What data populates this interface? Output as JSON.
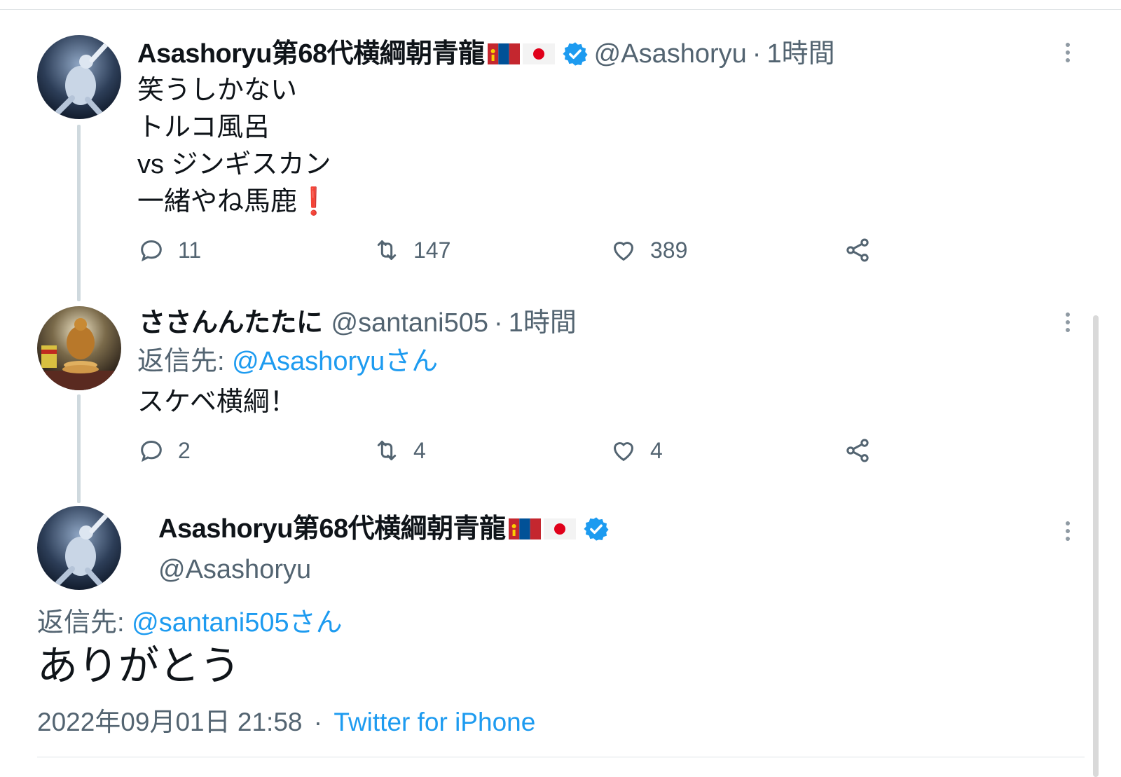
{
  "colors": {
    "accent": "#1d9bf0",
    "secondary_text": "#536471",
    "thread_line": "#cfd9de"
  },
  "tweet1": {
    "name": "Asashoryu第68代横綱朝青龍",
    "handle": "@Asashoryu",
    "separator": "·",
    "time": "1時間",
    "lines": [
      "笑うしかない",
      "トルコ風呂",
      "vs ジンギスカン",
      "一緒やね馬鹿"
    ],
    "emoji_after_last_line": "❗",
    "replies": "11",
    "retweets": "147",
    "likes": "389"
  },
  "tweet2": {
    "name": "ささんんたたに",
    "handle": "@santani505",
    "separator": "·",
    "time": "1時間",
    "reply_prefix": "返信先: ",
    "reply_mention": "@Asashoryuさん",
    "text": "スケベ横綱！",
    "replies": "2",
    "retweets": "4",
    "likes": "4"
  },
  "tweet3": {
    "name": "Asashoryu第68代横綱朝青龍",
    "handle": "@Asashoryu",
    "reply_prefix": "返信先: ",
    "reply_mention": "@santani505さん",
    "text": "ありがとう",
    "timestamp": "2022年09月01日 21:58",
    "separator": "·",
    "source": "Twitter for iPhone"
  }
}
